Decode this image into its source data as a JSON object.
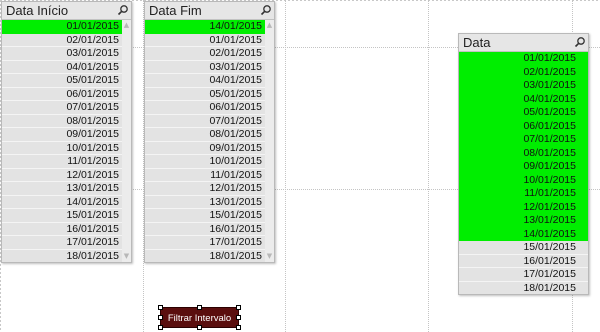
{
  "listboxes": {
    "inicio": {
      "title": "Data Início",
      "rows": [
        "01/01/2015",
        "02/01/2015",
        "03/01/2015",
        "04/01/2015",
        "05/01/2015",
        "06/01/2015",
        "07/01/2015",
        "08/01/2015",
        "09/01/2015",
        "10/01/2015",
        "11/01/2015",
        "12/01/2015",
        "13/01/2015",
        "14/01/2015",
        "15/01/2015",
        "16/01/2015",
        "17/01/2015",
        "18/01/2015"
      ],
      "selected": [
        0
      ]
    },
    "fim": {
      "title": "Data Fim",
      "rows": [
        "14/01/2015",
        "01/01/2015",
        "02/01/2015",
        "03/01/2015",
        "04/01/2015",
        "05/01/2015",
        "06/01/2015",
        "07/01/2015",
        "08/01/2015",
        "09/01/2015",
        "10/01/2015",
        "11/01/2015",
        "12/01/2015",
        "13/01/2015",
        "15/01/2015",
        "16/01/2015",
        "17/01/2015",
        "18/01/2015"
      ],
      "selected": [
        0
      ]
    },
    "data": {
      "title": "Data",
      "rows": [
        "01/01/2015",
        "02/01/2015",
        "03/01/2015",
        "04/01/2015",
        "05/01/2015",
        "06/01/2015",
        "07/01/2015",
        "08/01/2015",
        "09/01/2015",
        "10/01/2015",
        "11/01/2015",
        "12/01/2015",
        "13/01/2015",
        "14/01/2015",
        "15/01/2015",
        "16/01/2015",
        "17/01/2015",
        "18/01/2015"
      ],
      "selected": [
        0,
        1,
        2,
        3,
        4,
        5,
        6,
        7,
        8,
        9,
        10,
        11,
        12,
        13
      ]
    }
  },
  "button": {
    "label": "Filtrar Intervalo"
  },
  "colors": {
    "selected": "#00ee00",
    "unselected": "#e3e3e3",
    "button_bg": "#5a0e0e"
  },
  "icons": {
    "search": "search-icon"
  }
}
